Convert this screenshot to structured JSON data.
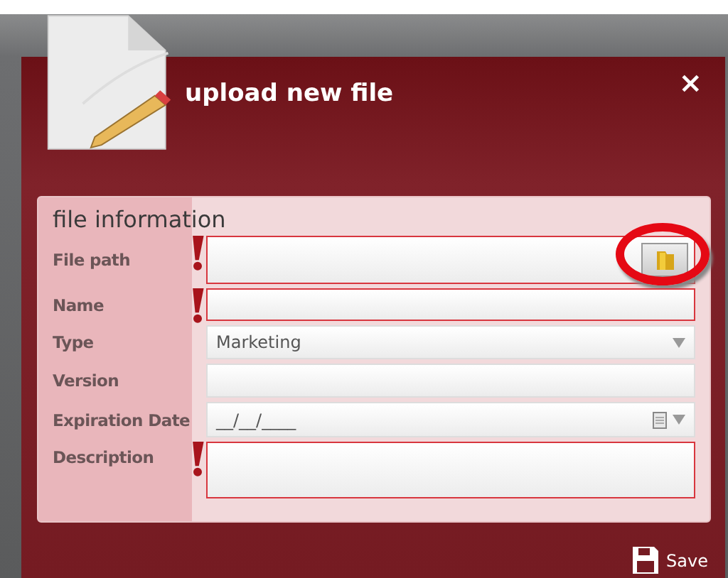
{
  "dialog": {
    "title": "upload new file",
    "close": "×"
  },
  "section": {
    "title": "file information"
  },
  "fields": [
    {
      "label": "File path",
      "kind": "file",
      "required": true,
      "highlighted": true
    },
    {
      "label": "Name",
      "kind": "text",
      "required": true
    },
    {
      "label": "Type",
      "kind": "select",
      "required": false,
      "value": "Marketing"
    },
    {
      "label": "Version",
      "kind": "text",
      "required": false
    },
    {
      "label": "Expiration Date",
      "kind": "date",
      "required": false,
      "value": "__/__/____"
    },
    {
      "label": "Description",
      "kind": "textarea",
      "required": true
    }
  ],
  "footer": {
    "save": "Save"
  }
}
